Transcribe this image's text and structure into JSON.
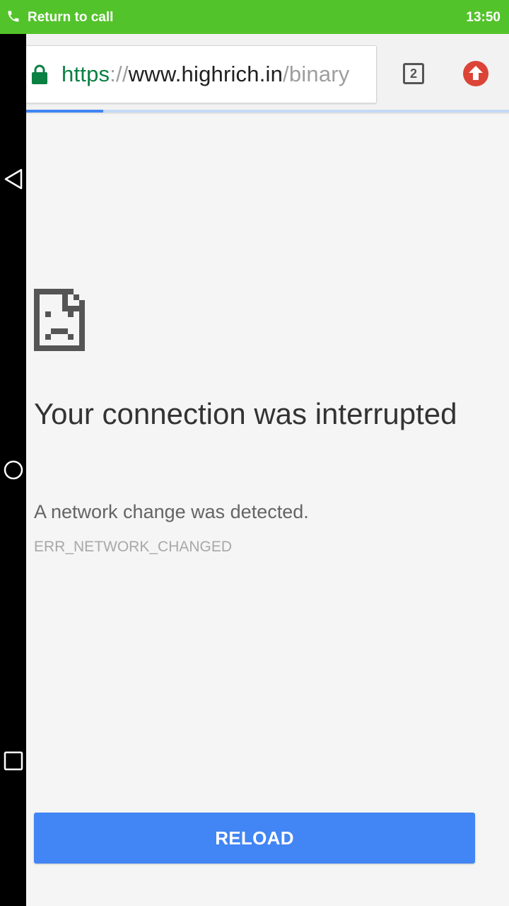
{
  "status_bar": {
    "call_label": "Return to call",
    "time": "13:50",
    "background_color": "#53c32b",
    "call_icon": "phone-icon"
  },
  "nav_bar": {
    "buttons": [
      "back-icon",
      "home-icon",
      "recents-icon"
    ]
  },
  "toolbar": {
    "url": {
      "scheme": "https",
      "separator": "://",
      "host": "www.highrich.in",
      "path": "/binary"
    },
    "secure_icon": "lock-icon",
    "tab_count": "2",
    "update_icon": "update-arrow-icon",
    "page_load_progress": 0.16
  },
  "error_page": {
    "icon": "sad-page-icon",
    "headline": "Your connection was interrupted",
    "description": "A network change was detected.",
    "error_code": "ERR_NETWORK_CHANGED",
    "reload_label": "RELOAD",
    "accent_color": "#4285f4"
  }
}
